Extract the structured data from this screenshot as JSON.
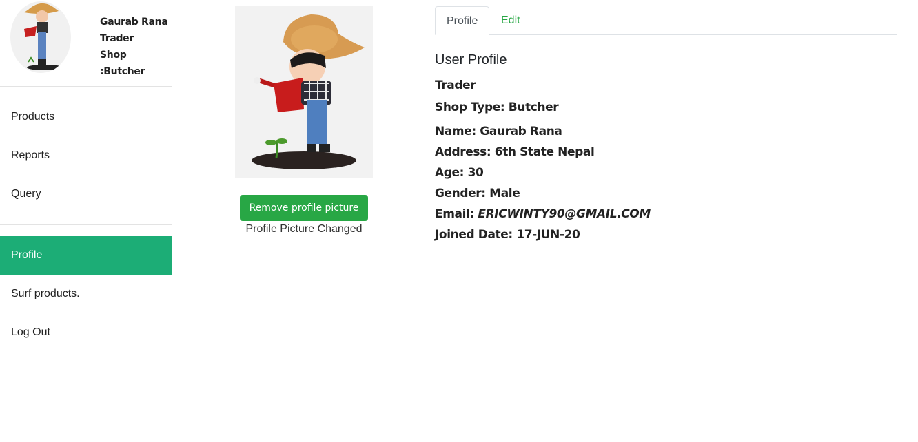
{
  "sidebar": {
    "user": {
      "name": "Gaurab Rana",
      "role": "Trader",
      "shop": "Shop :Butcher"
    },
    "nav_top": [
      {
        "label": "Products"
      },
      {
        "label": "Reports"
      },
      {
        "label": "Query"
      }
    ],
    "nav_bottom": [
      {
        "label": "Profile",
        "active": true
      },
      {
        "label": "Surf products."
      },
      {
        "label": "Log Out"
      }
    ]
  },
  "picture": {
    "remove_label": "Remove profile picture",
    "status": "Profile Picture Changed"
  },
  "tabs": [
    {
      "label": "Profile",
      "active": true
    },
    {
      "label": "Edit"
    }
  ],
  "profile": {
    "title": "User Profile",
    "role": "Trader",
    "shop_type": "Shop Type: Butcher",
    "name": "Name: Gaurab Rana",
    "address": "Address: 6th State Nepal",
    "age": "Age: 30",
    "gender": "Gender: Male",
    "email_label": "Email: ",
    "email_value": "ERICWINTY90@GMAIL.COM",
    "joined": "Joined Date: 17-JUN-20"
  },
  "colors": {
    "accent_green": "#1cad76",
    "button_green": "#28a745"
  }
}
